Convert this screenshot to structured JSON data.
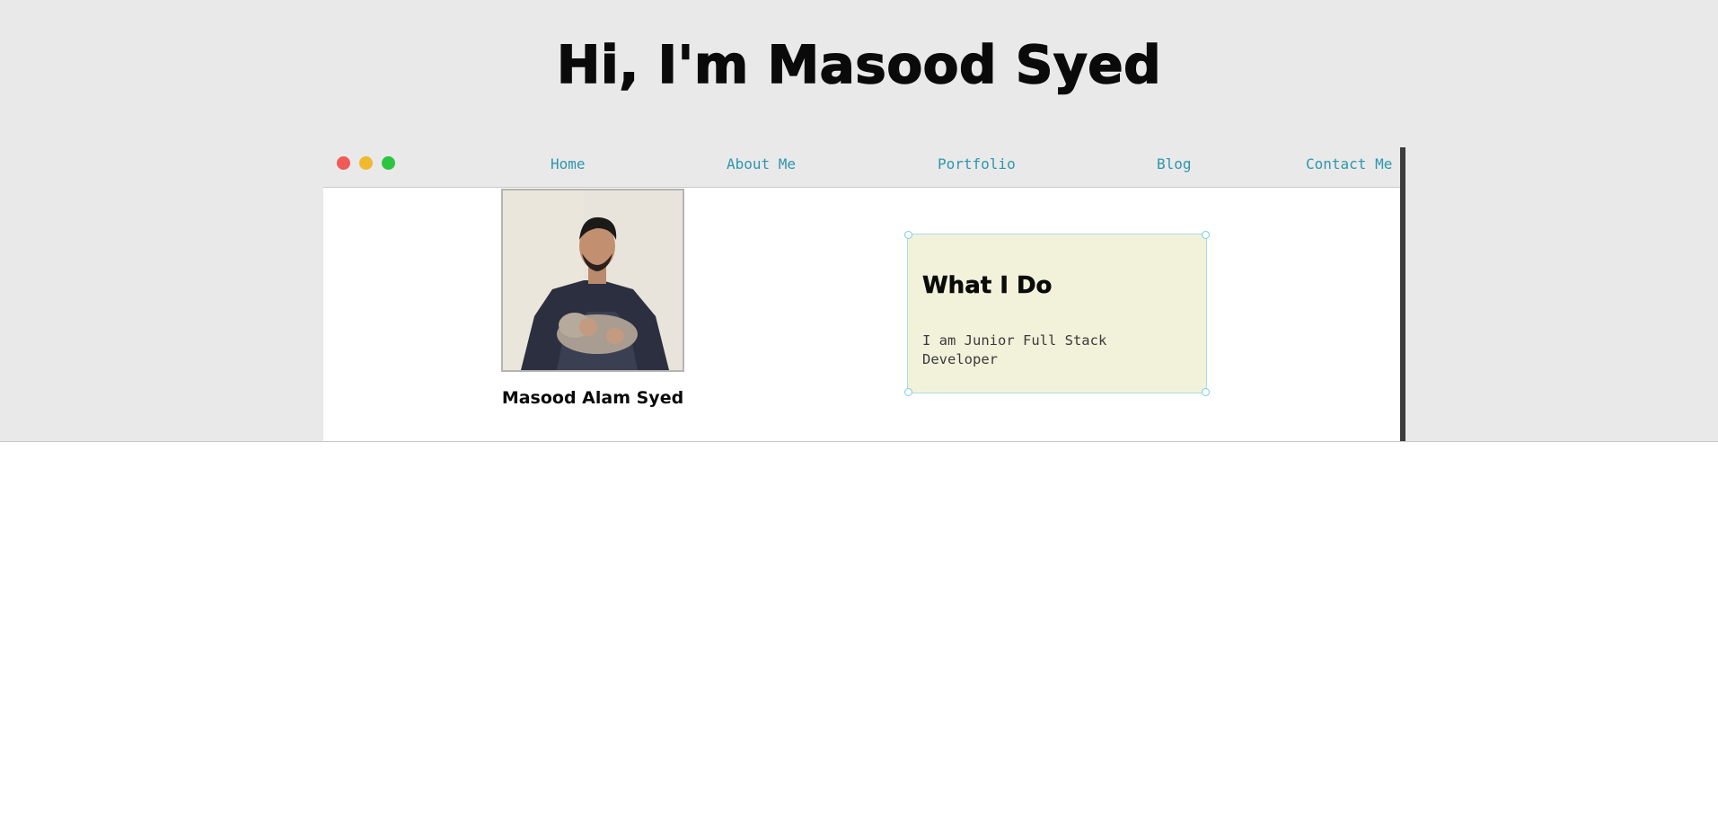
{
  "hero": {
    "title": "Hi, I'm Masood Syed"
  },
  "nav": {
    "items": [
      {
        "label": "Home"
      },
      {
        "label": "About Me"
      },
      {
        "label": "Portfolio"
      },
      {
        "label": "Blog"
      },
      {
        "label": "Contact Me"
      }
    ]
  },
  "window_controls": [
    "close-dot",
    "minimize-dot",
    "maximize-dot"
  ],
  "profile": {
    "name": "Masood Alam Syed",
    "photo_icon": "profile-photo"
  },
  "card": {
    "title": "What I Do",
    "text": "I am Junior Full Stack Developer"
  },
  "colors": {
    "hero_bg": "#e9e9e9",
    "nav_link": "#2f96ad",
    "card_bg": "#f2f2db",
    "card_border": "#a9dbe8",
    "dot_red": "#f05a57",
    "dot_yellow": "#f1b930",
    "dot_green": "#2cc441"
  }
}
